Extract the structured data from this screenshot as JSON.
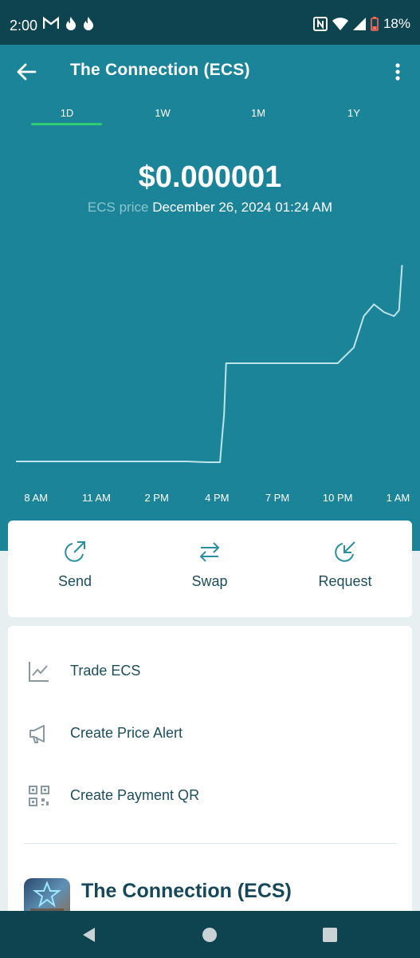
{
  "status_bar": {
    "time": "2:00",
    "battery": "18%",
    "icons": [
      "gmail-icon",
      "tinder-flame-icon",
      "tinder-flame-icon",
      "nfc-icon",
      "wifi-icon",
      "signal-icon",
      "battery-icon"
    ]
  },
  "header": {
    "title": "The Connection (ECS)",
    "icons": [
      "back-arrow-icon",
      "more-vertical-icon"
    ],
    "tabs": [
      "1D",
      "1W",
      "1M",
      "1Y"
    ],
    "selected_tab": "1D"
  },
  "price": {
    "value": "$0.000001",
    "label": "ECS price",
    "timestamp": "December 26, 2024 01:24 AM"
  },
  "chart_data": {
    "type": "line",
    "title": "",
    "xlabel": "",
    "ylabel": "",
    "x_tick_labels": [
      "8 AM",
      "11 AM",
      "2 PM",
      "4 PM",
      "7 PM",
      "10 PM",
      "1 AM"
    ],
    "x_ticks_hours": [
      8,
      11,
      14,
      17,
      20,
      23,
      26
    ],
    "x": [
      7,
      8,
      10,
      12,
      14,
      15.5,
      16.5,
      17.15,
      17.25,
      17.35,
      17.45,
      18,
      20,
      22,
      23,
      23.8,
      24.3,
      24.8,
      25.3,
      25.8,
      26.05,
      26.2
    ],
    "y": [
      0.0,
      0.0,
      0.0,
      0.0,
      0.0,
      0.0,
      -0.004,
      -0.004,
      0.12,
      0.24,
      0.5,
      0.5,
      0.5,
      0.5,
      0.5,
      0.58,
      0.74,
      0.8,
      0.76,
      0.74,
      0.77,
      1.0
    ],
    "y_unit": "relative (axis unlabeled)",
    "grid": false,
    "line_color": "#bfe3ea"
  },
  "actions": [
    {
      "label": "Send",
      "icon": "send-arrow-icon"
    },
    {
      "label": "Swap",
      "icon": "swap-arrows-icon"
    },
    {
      "label": "Request",
      "icon": "request-arrow-icon"
    }
  ],
  "menu": [
    {
      "label": "Trade ECS",
      "icon": "trend-chart-icon"
    },
    {
      "label": "Create Price Alert",
      "icon": "megaphone-icon"
    },
    {
      "label": "Create Payment QR",
      "icon": "qr-code-icon"
    }
  ],
  "coin": {
    "title": "The Connection (ECS)",
    "logo": "coin-logo-image"
  },
  "nav": [
    "back-triangle-icon",
    "home-circle-icon",
    "recents-square-icon"
  ],
  "colors": {
    "header": "#1b8498",
    "status": "#0e4350",
    "accent": "#2ecc71",
    "text": "#1c4e5e",
    "icon": "#2a8ea3"
  }
}
